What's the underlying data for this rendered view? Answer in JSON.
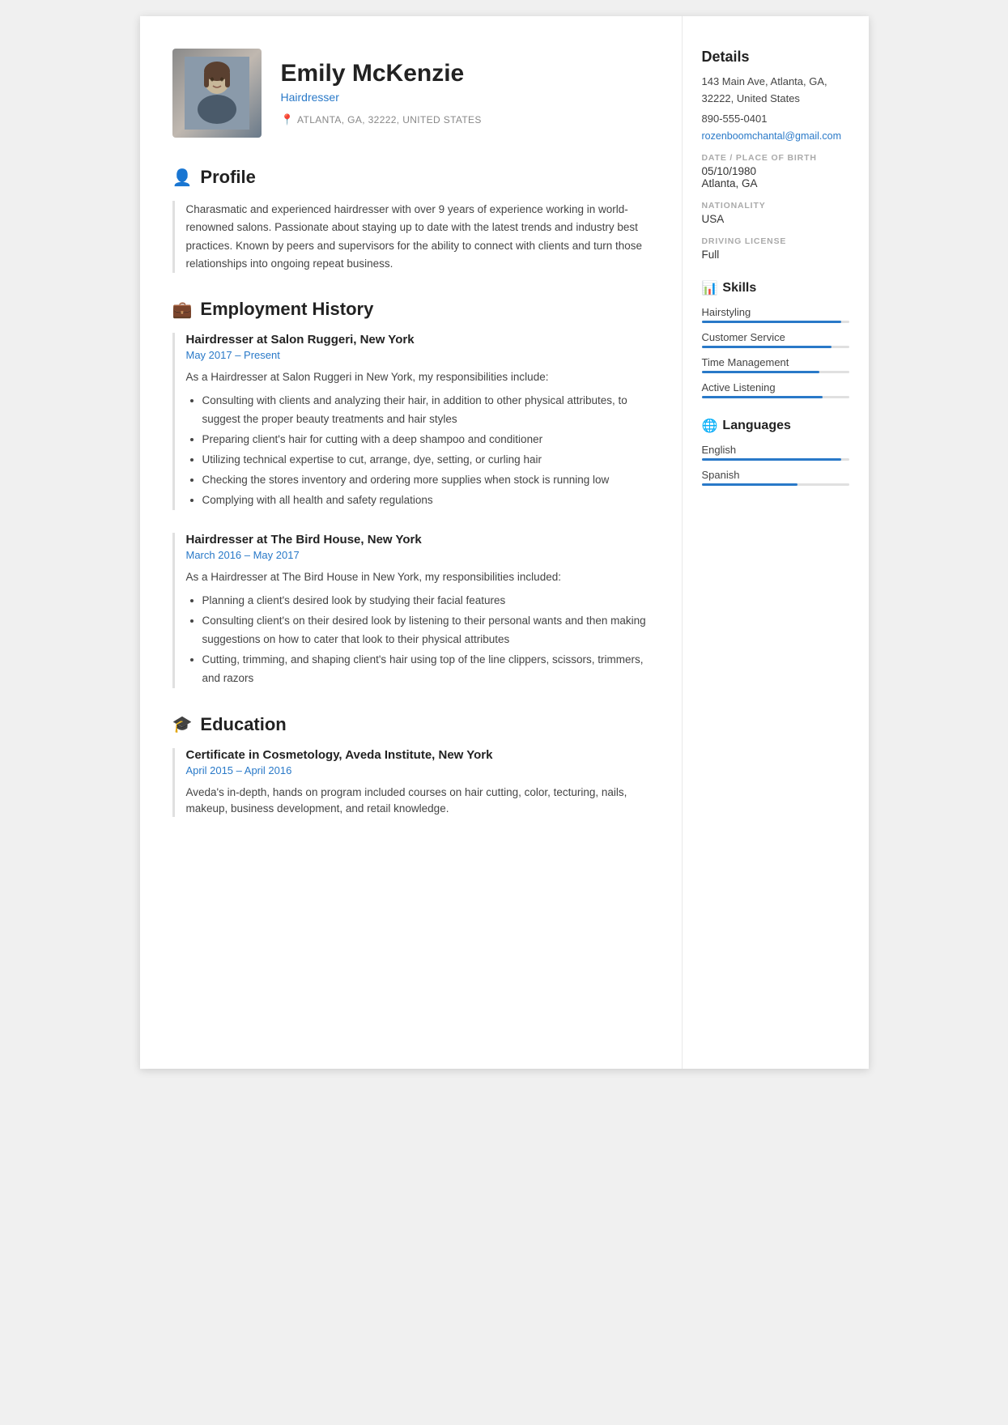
{
  "header": {
    "name": "Emily McKenzie",
    "title": "Hairdresser",
    "location": "ATLANTA, GA, 32222, UNITED STATES"
  },
  "profile": {
    "section_icon": "👤",
    "section_title": "Profile",
    "text": "Charasmatic and experienced hairdresser with over 9 years of experience working in world-renowned salons. Passionate about staying up to date with the latest trends and industry best practices. Known by peers and supervisors for the ability to connect with clients and turn those relationships into ongoing repeat business."
  },
  "employment": {
    "section_icon": "💼",
    "section_title": "Employment History",
    "jobs": [
      {
        "title": "Hairdresser at Salon Ruggeri, New York",
        "date": "May 2017  –  Present",
        "intro": "As a Hairdresser at Salon Ruggeri in New York, my responsibilities include:",
        "bullets": [
          "Consulting with clients and analyzing their hair, in addition to other physical attributes, to suggest the proper beauty treatments and hair styles",
          "Preparing client's hair for cutting with a deep shampoo and conditioner",
          "Utilizing technical expertise to cut, arrange, dye, setting, or curling hair",
          "Checking the stores inventory and ordering more supplies when stock is running low",
          "Complying with all health and safety regulations"
        ]
      },
      {
        "title": "Hairdresser at The Bird House, New York",
        "date": "March 2016  –  May 2017",
        "intro": "As a Hairdresser at The Bird House in New York, my responsibilities included:",
        "bullets": [
          "Planning a client's desired look by studying their facial features",
          "Consulting client's on their desired look by listening to their personal wants and then making suggestions on how to cater that look to their physical attributes",
          "Cutting, trimming, and shaping client's hair using top of the line clippers, scissors, trimmers, and razors"
        ]
      }
    ]
  },
  "education": {
    "section_icon": "🎓",
    "section_title": "Education",
    "entries": [
      {
        "title": "Certificate in Cosmetology, Aveda Institute, New York",
        "date": "April 2015  –  April 2016",
        "text": "Aveda's in-depth, hands on program included courses on hair cutting, color, tecturing, nails, makeup, business development, and retail knowledge."
      }
    ]
  },
  "details": {
    "section_title": "Details",
    "address": "143 Main Ave, Atlanta, GA, 32222, United States",
    "phone": "890-555-0401",
    "email": "rozenboomchantal@gmail.com",
    "dob_label": "DATE / PLACE OF BIRTH",
    "dob": "05/10/1980",
    "birthplace": "Atlanta, GA",
    "nationality_label": "NATIONALITY",
    "nationality": "USA",
    "driving_label": "DRIVING LICENSE",
    "driving": "Full"
  },
  "skills": {
    "section_icon": "📊",
    "section_title": "Skills",
    "items": [
      {
        "name": "Hairstyling",
        "level": 95
      },
      {
        "name": "Customer Service",
        "level": 88
      },
      {
        "name": "Time Management",
        "level": 80
      },
      {
        "name": "Active Listening",
        "level": 82
      }
    ]
  },
  "languages": {
    "section_icon": "🌐",
    "section_title": "Languages",
    "items": [
      {
        "name": "English",
        "level": 95
      },
      {
        "name": "Spanish",
        "level": 65
      }
    ]
  }
}
